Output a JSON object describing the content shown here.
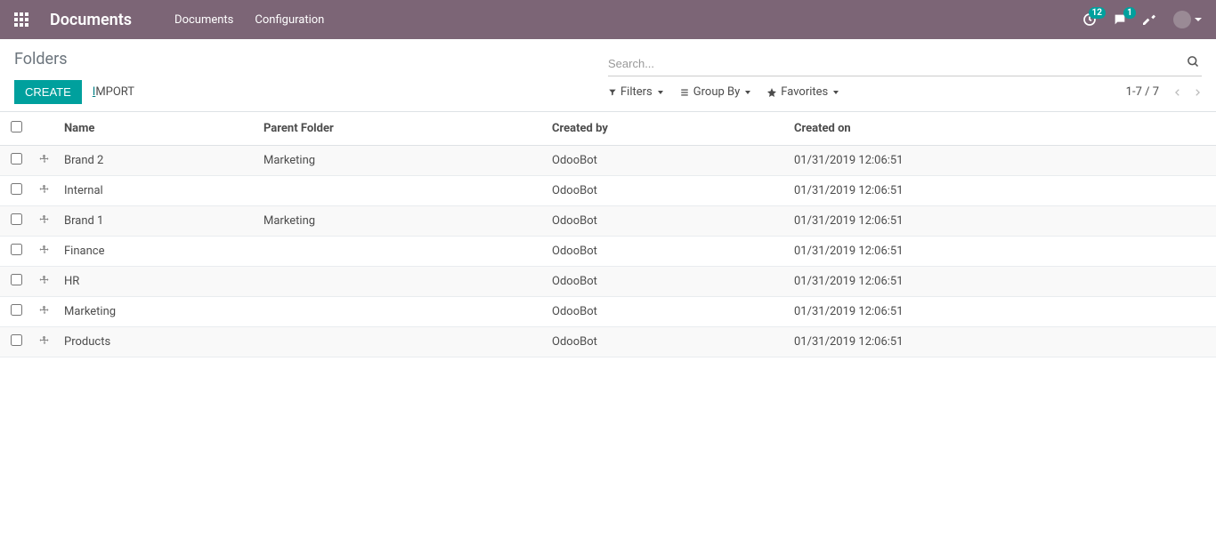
{
  "navbar": {
    "brand": "Documents",
    "links": [
      "Documents",
      "Configuration"
    ],
    "clock_badge": "12",
    "chat_badge": "1"
  },
  "breadcrumb": "Folders",
  "search": {
    "placeholder": "Search..."
  },
  "buttons": {
    "create": "Create",
    "import_prefix": "I",
    "import_rest": "mport"
  },
  "toolbar": {
    "filters": "Filters",
    "group_by": "Group By",
    "favorites": "Favorites"
  },
  "pager": {
    "text": "1-7 / 7"
  },
  "columns": {
    "name": "Name",
    "parent": "Parent Folder",
    "created_by": "Created by",
    "created_on": "Created on"
  },
  "rows": [
    {
      "name": "Brand 2",
      "parent": "Marketing",
      "created_by": "OdooBot",
      "created_on": "01/31/2019 12:06:51"
    },
    {
      "name": "Internal",
      "parent": "",
      "created_by": "OdooBot",
      "created_on": "01/31/2019 12:06:51"
    },
    {
      "name": "Brand 1",
      "parent": "Marketing",
      "created_by": "OdooBot",
      "created_on": "01/31/2019 12:06:51"
    },
    {
      "name": "Finance",
      "parent": "",
      "created_by": "OdooBot",
      "created_on": "01/31/2019 12:06:51"
    },
    {
      "name": "HR",
      "parent": "",
      "created_by": "OdooBot",
      "created_on": "01/31/2019 12:06:51"
    },
    {
      "name": "Marketing",
      "parent": "",
      "created_by": "OdooBot",
      "created_on": "01/31/2019 12:06:51"
    },
    {
      "name": "Products",
      "parent": "",
      "created_by": "OdooBot",
      "created_on": "01/31/2019 12:06:51"
    }
  ]
}
